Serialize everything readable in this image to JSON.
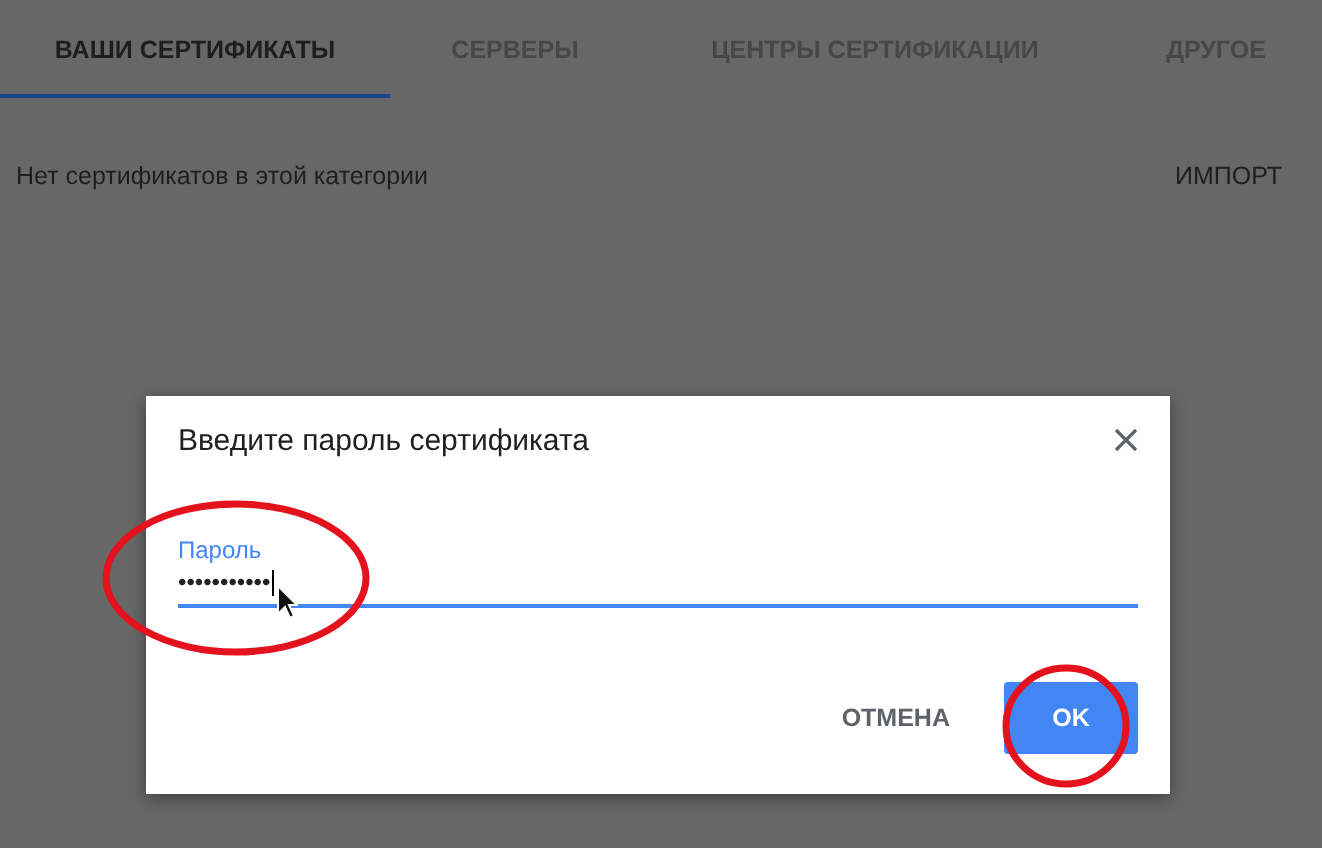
{
  "tabs": [
    {
      "label": "ВАШИ СЕРТИФИКАТЫ",
      "selected": true
    },
    {
      "label": "СЕРВЕРЫ",
      "selected": false
    },
    {
      "label": "ЦЕНТРЫ СЕРТИФИКАЦИИ",
      "selected": false
    },
    {
      "label": "ДРУГОЕ",
      "selected": false
    }
  ],
  "content": {
    "empty_message": "Нет сертификатов в этой категории",
    "import_button": "ИМПОРТ"
  },
  "dialog": {
    "title": "Введите пароль сертификата",
    "field": {
      "label": "Пароль",
      "value": "•••••••••••"
    },
    "buttons": [
      {
        "label": "ОТМЕНА",
        "kind": "text"
      },
      {
        "label": "OK",
        "kind": "primary"
      }
    ]
  }
}
